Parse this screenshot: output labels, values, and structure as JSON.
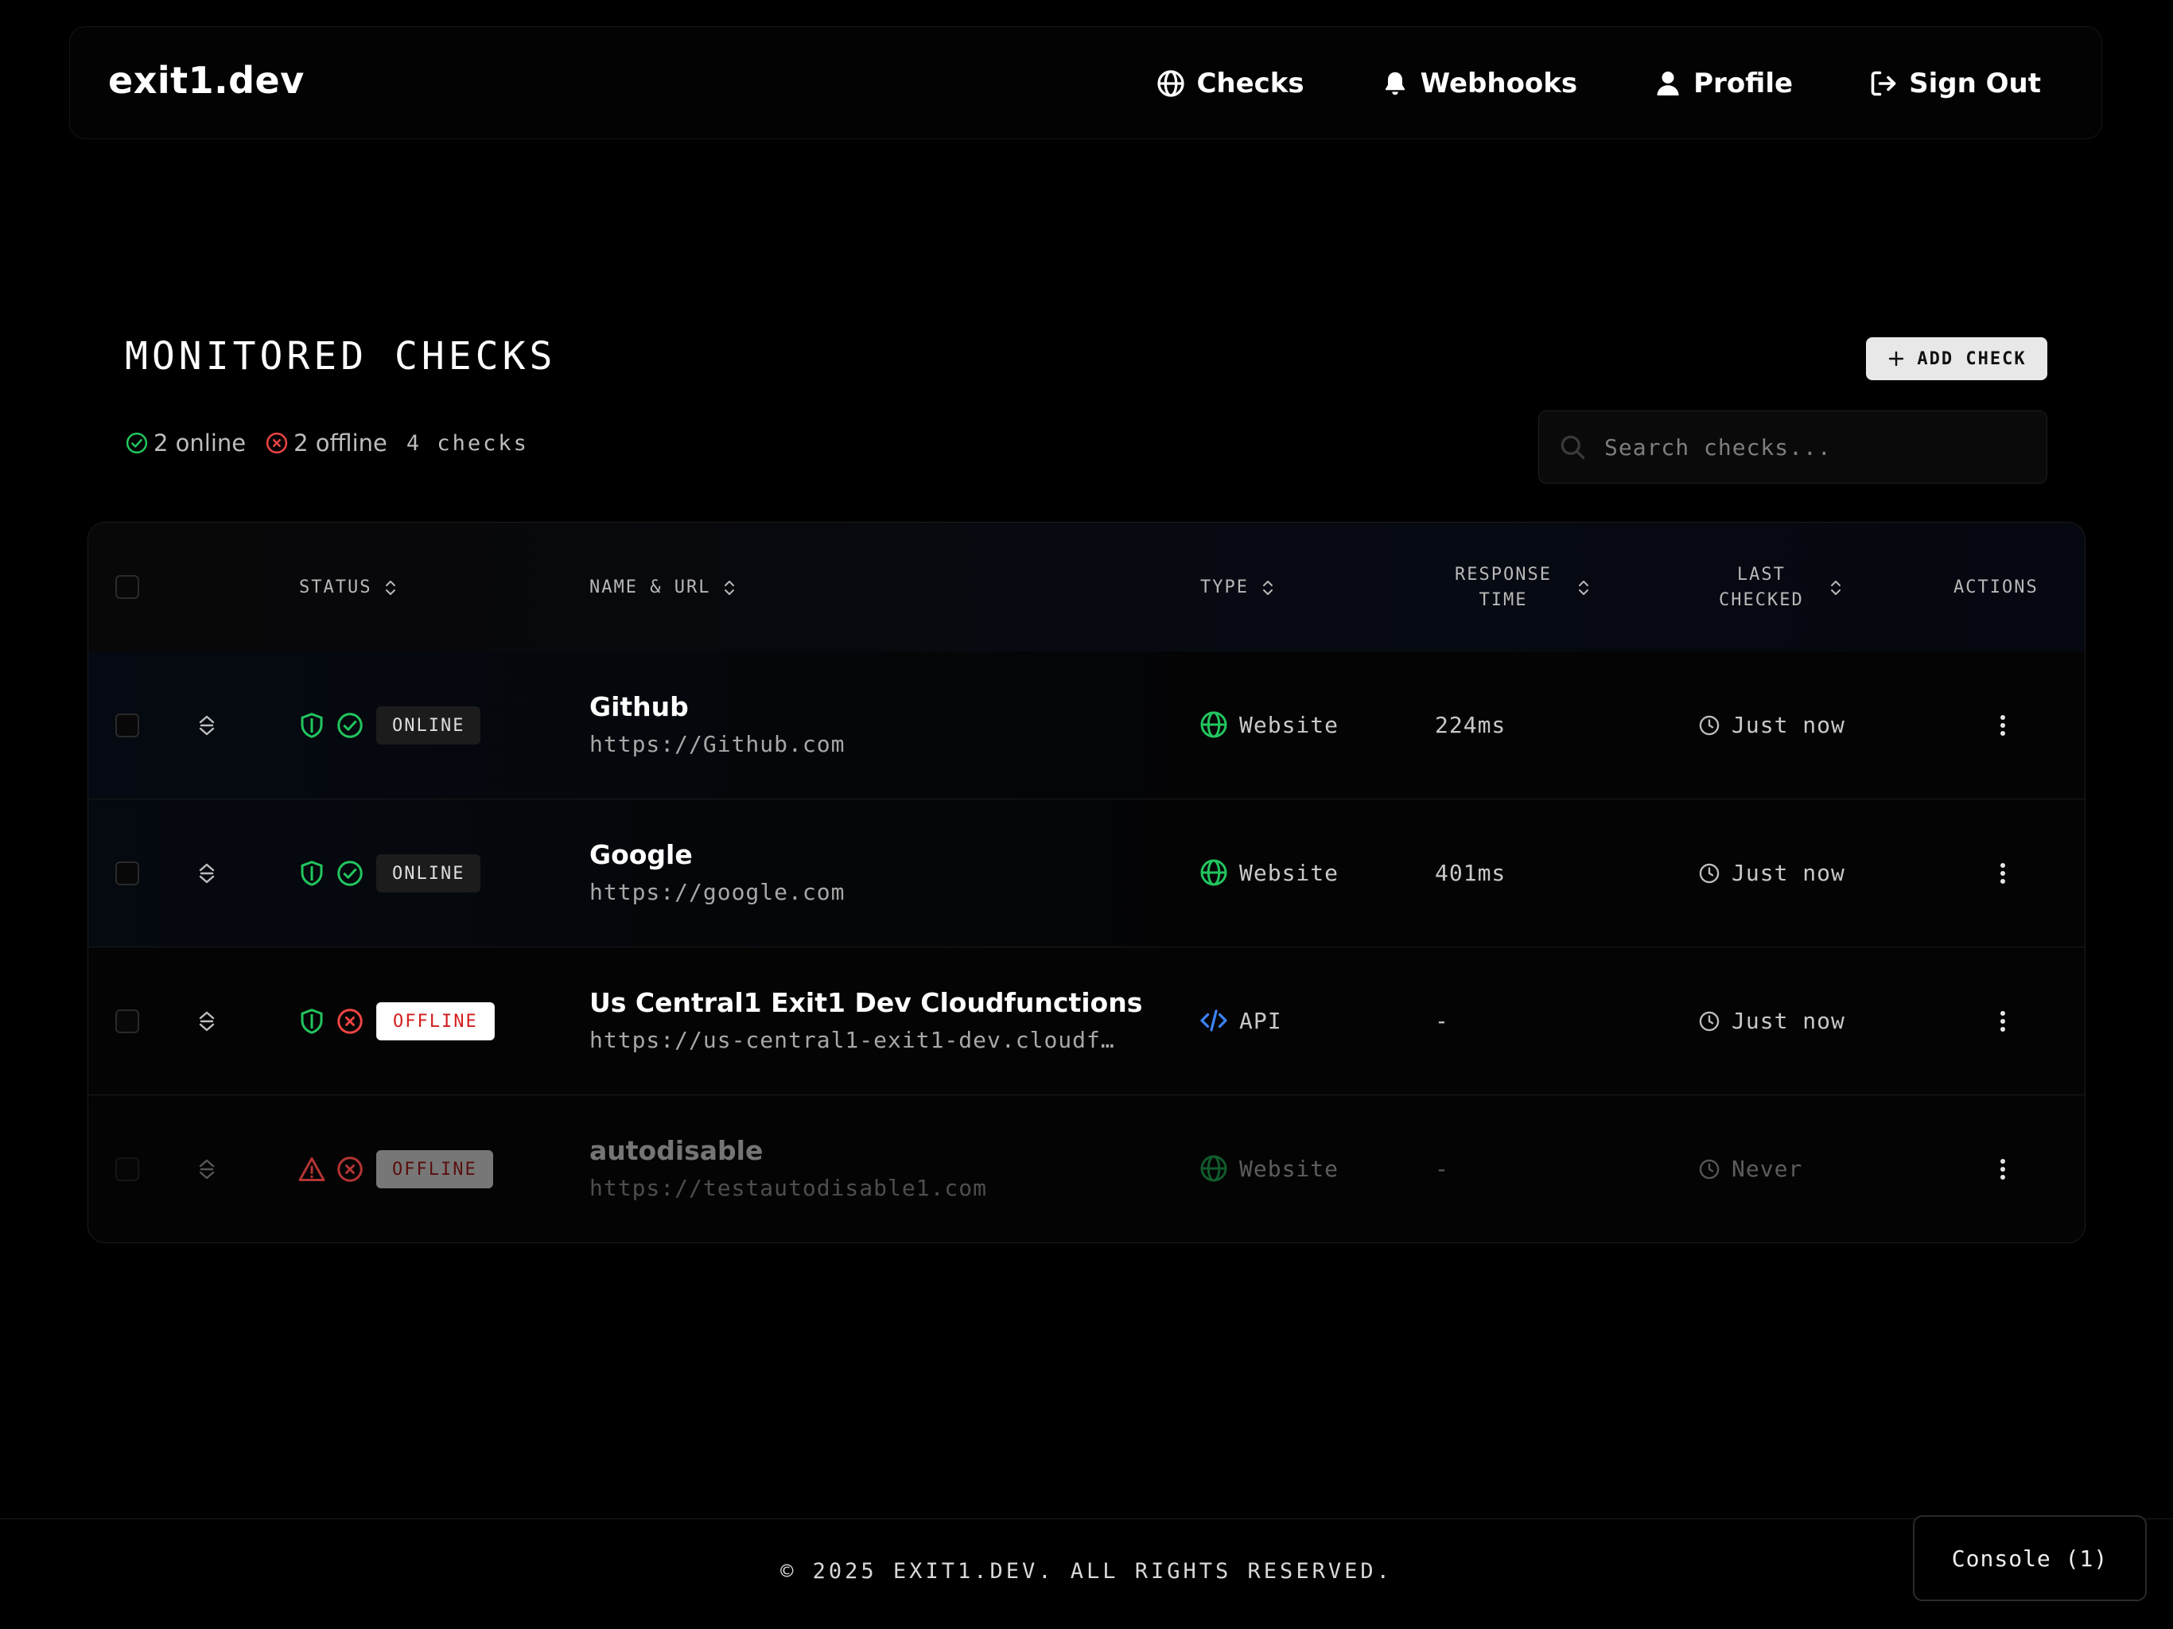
{
  "nav": {
    "brand": "exit1.dev",
    "links": [
      {
        "label": "Checks",
        "icon": "globe-icon"
      },
      {
        "label": "Webhooks",
        "icon": "bell-icon"
      },
      {
        "label": "Profile",
        "icon": "user-icon"
      },
      {
        "label": "Sign Out",
        "icon": "sign-out-icon"
      }
    ]
  },
  "header": {
    "title": "MONITORED CHECKS",
    "add_button": "ADD CHECK",
    "summary": {
      "online": "2 online",
      "offline": "2 offline",
      "count": "4 checks"
    },
    "search_placeholder": "Search checks..."
  },
  "table": {
    "columns": {
      "status": "STATUS",
      "name_url": "NAME & URL",
      "type": "TYPE",
      "response_line1": "RESPONSE",
      "response_line2": "TIME",
      "last_line1": "LAST",
      "last_line2": "CHECKED",
      "actions": "ACTIONS"
    },
    "rows": [
      {
        "status": "ONLINE",
        "name": "Github",
        "url": "https://Github.com",
        "type": "Website",
        "response": "224ms",
        "last_checked": "Just now"
      },
      {
        "status": "ONLINE",
        "name": "Google",
        "url": "https://google.com",
        "type": "Website",
        "response": "401ms",
        "last_checked": "Just now"
      },
      {
        "status": "OFFLINE",
        "name": "Us Central1 Exit1 Dev Cloudfunctions",
        "url": "https://us-central1-exit1-dev.cloudf…",
        "type": "API",
        "response": "-",
        "last_checked": "Just now"
      },
      {
        "status": "OFFLINE",
        "name": "autodisable",
        "url": "https://testautodisable1.com",
        "type": "Website",
        "response": "-",
        "last_checked": "Never"
      }
    ]
  },
  "footer": {
    "copyright": "© 2025 EXIT1.DEV. ALL RIGHTS RESERVED.",
    "console": "Console (1)"
  },
  "colors": {
    "background": "#000000",
    "online": "#22c55e",
    "offline": "#ef4444",
    "api": "#3b82f6"
  }
}
